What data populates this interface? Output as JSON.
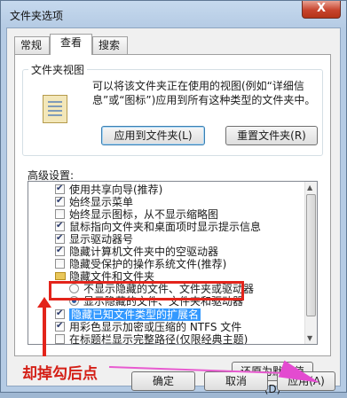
{
  "window": {
    "title": "文件夹选项",
    "close_label": "X"
  },
  "tabs": [
    "常规",
    "查看",
    "搜索"
  ],
  "folder_views": {
    "title": "文件夹视图",
    "description": "可以将该文件夹正在使用的视图(例如“详细信息”或“图标”)应用到所有这种类型的文件夹中。",
    "apply_button": "应用到文件夹(L)",
    "reset_button": "重置文件夹(R)"
  },
  "advanced": {
    "title": "高级设置:",
    "items": [
      {
        "type": "checkbox",
        "checked": true,
        "label": "使用共享向导(推荐)"
      },
      {
        "type": "checkbox",
        "checked": true,
        "label": "始终显示菜单"
      },
      {
        "type": "checkbox",
        "checked": false,
        "label": "始终显示图标，从不显示缩略图"
      },
      {
        "type": "checkbox",
        "checked": true,
        "label": "鼠标指向文件夹和桌面项时显示提示信息"
      },
      {
        "type": "checkbox",
        "checked": true,
        "label": "显示驱动器号"
      },
      {
        "type": "checkbox",
        "checked": false,
        "label": "隐藏计算机文件夹中的空驱动器"
      },
      {
        "type": "checkbox",
        "checked": true,
        "label": "隐藏受保护的操作系统文件(推荐)"
      },
      {
        "type": "folder",
        "checked": false,
        "label": "隐藏文件和文件夹"
      },
      {
        "type": "radio",
        "checked": false,
        "label": "不显示隐藏的文件、文件夹或驱动器"
      },
      {
        "type": "radio",
        "checked": true,
        "label": "显示隐藏的文件、文件夹和驱动器"
      },
      {
        "type": "checkbox",
        "checked": true,
        "label": "隐藏已知文件类型的扩展名",
        "highlighted": true
      },
      {
        "type": "checkbox",
        "checked": true,
        "label": "用彩色显示加密或压缩的 NTFS 文件"
      },
      {
        "type": "checkbox",
        "checked": false,
        "label": "在标题栏显示完整路径(仅限经典主题)"
      }
    ],
    "restore_button": "还原为默认值(D)"
  },
  "footer": {
    "ok": "确定",
    "cancel": "取消",
    "apply": "应用(A)"
  },
  "annotation": {
    "text": "却掉勾后点",
    "color": "#d41f16"
  },
  "colors": {
    "highlight": "#3399ff",
    "annotation_red": "#e3241b",
    "arrow_magenta": "#e34bd0"
  }
}
